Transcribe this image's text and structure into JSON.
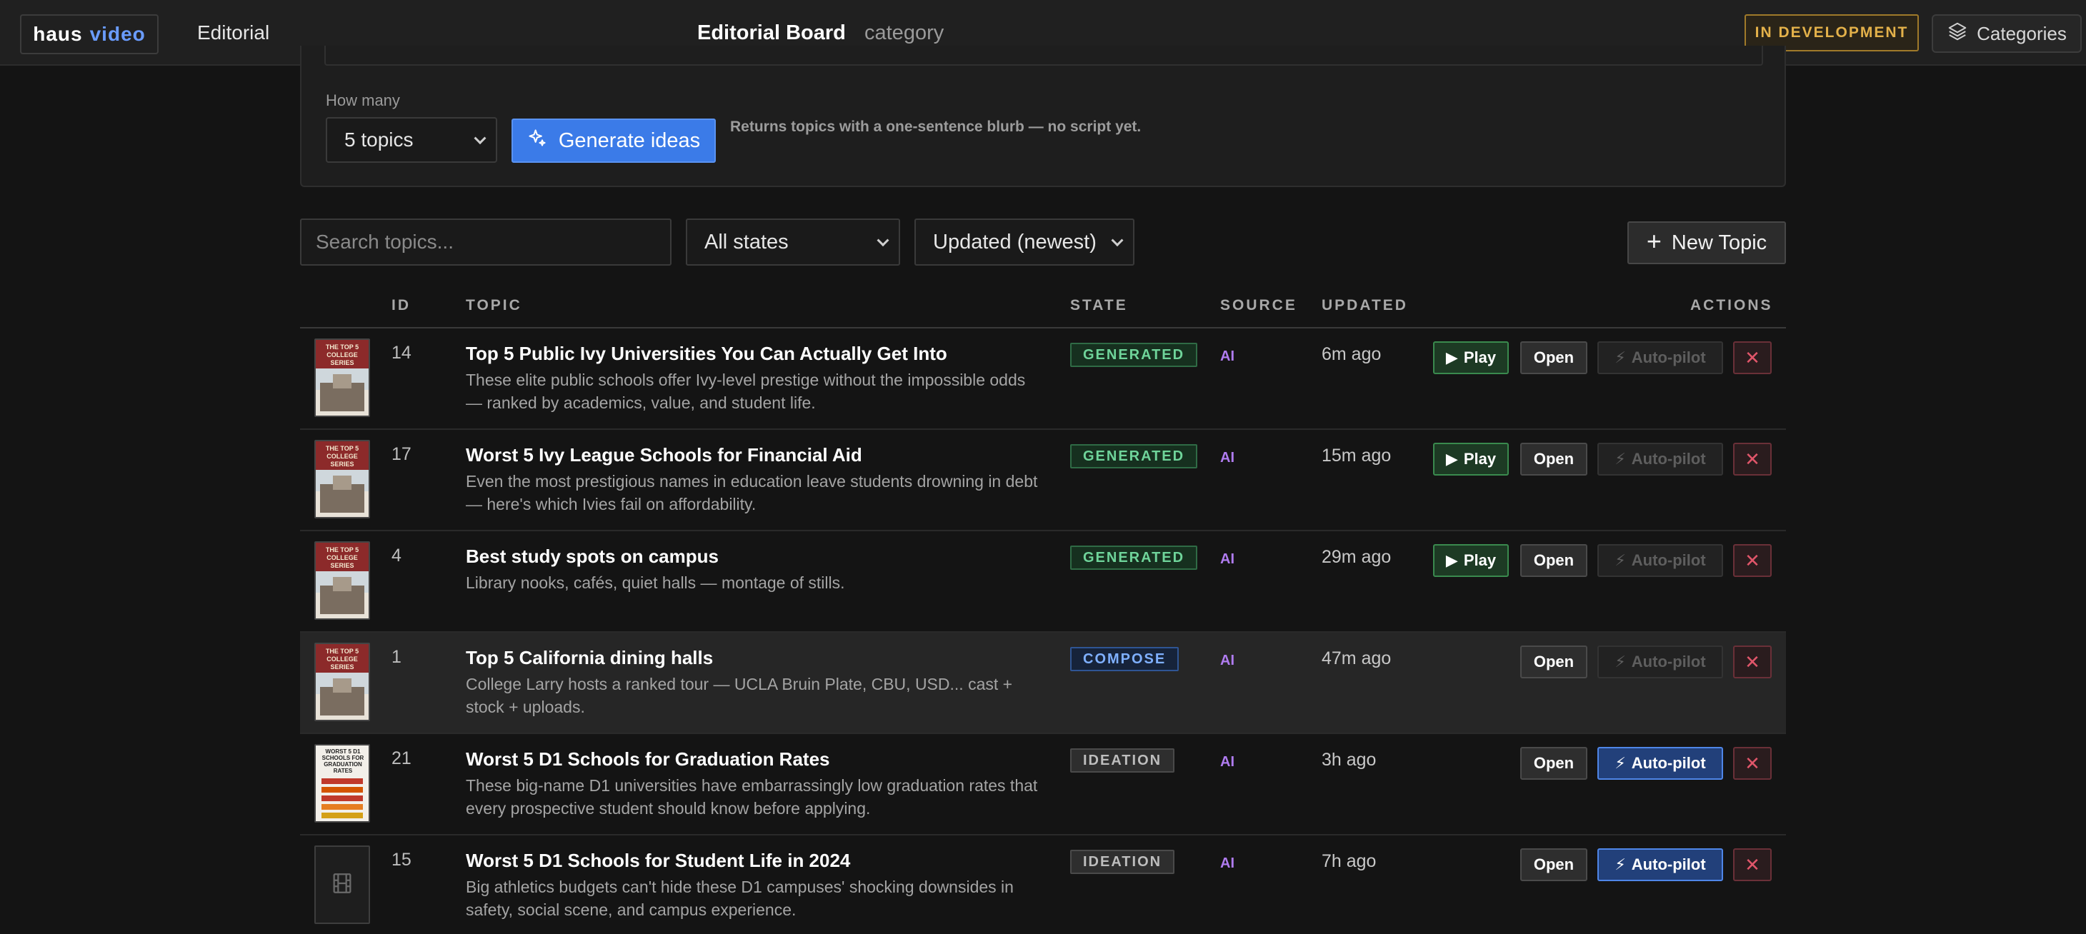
{
  "header": {
    "logo_part1": "haus",
    "logo_part2": "video",
    "nav_editorial": "Editorial",
    "page_title": "Editorial Board",
    "page_subtitle": "category",
    "dev_badge": "IN DEVELOPMENT",
    "categories_label": "Categories"
  },
  "generator": {
    "how_many_label": "How many",
    "how_many_value": "5 topics",
    "generate_label": "Generate ideas",
    "hint": "Returns topics with a one-sentence blurb — no script yet."
  },
  "filters": {
    "search_placeholder": "Search topics...",
    "state_value": "All states",
    "sort_value": "Updated (newest)",
    "new_topic_label": "New Topic"
  },
  "table": {
    "columns": {
      "id": "ID",
      "topic": "TOPIC",
      "state": "STATE",
      "source": "SOURCE",
      "updated": "UPDATED",
      "actions": "ACTIONS"
    },
    "action_labels": {
      "play": "Play",
      "open": "Open",
      "autopilot": "Auto-pilot"
    },
    "rows": [
      {
        "id": "14",
        "title": "Top 5 Public Ivy Universities You Can Actually Get Into",
        "blurb": "These elite public schools offer Ivy-level prestige without the impossible odds — ranked by academics, value, and student life.",
        "state": "GENERATED",
        "source": "AI",
        "updated": "6m ago",
        "thumb_text": "THE TOP 5 COLLEGE SERIES"
      },
      {
        "id": "17",
        "title": "Worst 5 Ivy League Schools for Financial Aid",
        "blurb": "Even the most prestigious names in education leave students drowning in debt — here's which Ivies fail on affordability.",
        "state": "GENERATED",
        "source": "AI",
        "updated": "15m ago",
        "thumb_text": "THE TOP 5 COLLEGE SERIES"
      },
      {
        "id": "4",
        "title": "Best study spots on campus",
        "blurb": "Library nooks, cafés, quiet halls — montage of stills.",
        "state": "GENERATED",
        "source": "AI",
        "updated": "29m ago",
        "thumb_text": "THE TOP 5 COLLEGE SERIES"
      },
      {
        "id": "1",
        "title": "Top 5 California dining halls",
        "blurb": "College Larry hosts a ranked tour — UCLA Bruin Plate, CBU, USD... cast + stock + uploads.",
        "state": "COMPOSE",
        "source": "AI",
        "updated": "47m ago",
        "thumb_text": "THE TOP 5 COLLEGE SERIES"
      },
      {
        "id": "21",
        "title": "Worst 5 D1 Schools for Graduation Rates",
        "blurb": "These big-name D1 universities have embarrassingly low graduation rates that every prospective student should know before applying.",
        "state": "IDEATION",
        "source": "AI",
        "updated": "3h ago",
        "thumb_text": "WORST 5 D1 SCHOOLS FOR GRADUATION RATES"
      },
      {
        "id": "15",
        "title": "Worst 5 D1 Schools for Student Life in 2024",
        "blurb": "Big athletics budgets can't hide these D1 campuses' shocking downsides in safety, social scene, and campus experience.",
        "state": "IDEATION",
        "source": "AI",
        "updated": "7h ago"
      }
    ]
  },
  "colors": {
    "accent_blue": "#3b7be8",
    "generated_green": "#6fd49a",
    "compose_blue": "#7fb0ff",
    "ideation_gray": "#bdbdbd",
    "source_purple": "#b07cf0",
    "dev_gold": "#e3b14a",
    "delete_red": "#e0566a"
  },
  "icons": {
    "generate": "sparkle-icon",
    "categories": "layers-icon",
    "new_topic": "plus-icon",
    "play": "play-icon",
    "autopilot": "lightning-icon",
    "delete": "close-icon",
    "placeholder_thumb": "film-icon"
  }
}
